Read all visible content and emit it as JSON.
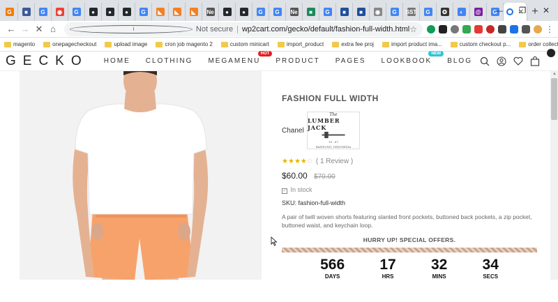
{
  "browser": {
    "url_prefix": "Not secure",
    "url": "wp2cart.com/gecko/default/fashion-full-width.html",
    "tabs": [
      {
        "glyph": "G",
        "color": "#f57c00"
      },
      {
        "glyph": "■",
        "color": "#3b5998"
      },
      {
        "glyph": "G",
        "color": "#4285f4"
      },
      {
        "glyph": "◉",
        "color": "#ea4335"
      },
      {
        "glyph": "G",
        "color": "#4285f4"
      },
      {
        "glyph": "●",
        "color": "#24292e"
      },
      {
        "glyph": "●",
        "color": "#24292e"
      },
      {
        "glyph": "●",
        "color": "#24292e"
      },
      {
        "glyph": "G",
        "color": "#4285f4"
      },
      {
        "glyph": "◣",
        "color": "#f48024"
      },
      {
        "glyph": "◣",
        "color": "#f48024"
      },
      {
        "glyph": "◣",
        "color": "#f48024"
      },
      {
        "glyph": "Ne",
        "color": "#555555"
      },
      {
        "glyph": "●",
        "color": "#24292e"
      },
      {
        "glyph": "●",
        "color": "#24292e"
      },
      {
        "glyph": "G",
        "color": "#4285f4"
      },
      {
        "glyph": "G",
        "color": "#4285f4"
      },
      {
        "glyph": "Ne",
        "color": "#555555"
      },
      {
        "glyph": "■",
        "color": "#1b8a5a"
      },
      {
        "glyph": "G",
        "color": "#4285f4"
      },
      {
        "glyph": "■",
        "color": "#1f4e9c"
      },
      {
        "glyph": "■",
        "color": "#1f4e9c"
      },
      {
        "glyph": "◉",
        "color": "#888888"
      },
      {
        "glyph": "G",
        "color": "#4285f4"
      },
      {
        "glyph": "SST",
        "color": "#777777"
      },
      {
        "glyph": "G",
        "color": "#4285f4"
      },
      {
        "glyph": "✪",
        "color": "#333333"
      },
      {
        "glyph": "◐",
        "color": "#4285f4"
      },
      {
        "glyph": "@",
        "color": "#7b1fa2"
      },
      {
        "glyph": "G",
        "color": "#4285f4"
      }
    ],
    "bookmarks": [
      "magento",
      "onepagecheckout",
      "upload image",
      "cron job magento 2",
      "custom minicart",
      "import_product",
      "extra fee proj",
      "import product ima...",
      "custom checkout p...",
      "order collection"
    ]
  },
  "site": {
    "logo": "GECKO",
    "nav": [
      {
        "label": "HOME",
        "badge": ""
      },
      {
        "label": "CLOTHING",
        "badge": ""
      },
      {
        "label": "MEGAMENU",
        "badge": "HOT"
      },
      {
        "label": "PRODUCT",
        "badge": ""
      },
      {
        "label": "PAGES",
        "badge": ""
      },
      {
        "label": "LOOKBOOK",
        "badge": "NEW"
      },
      {
        "label": "BLOG",
        "badge": ""
      }
    ]
  },
  "product": {
    "title": "FASHION FULL WIDTH",
    "brand_label": "Chanel",
    "brand_logo": {
      "top": "The",
      "name": "LUMBER JACK",
      "sub": "BANDUNG, INDONESIA",
      "est": "19 · 67"
    },
    "rating": 4,
    "rating_max": 5,
    "review_text": "( 1  Review )",
    "price": "$60.00",
    "old_price": "$70.00",
    "stock": "In stock",
    "sku_label": "SKU:",
    "sku": "fashion-full-width",
    "description": "A pair of twill woven shorts featuring slanted front pockets, buttoned back pockets, a zip pocket, buttoned waist, and keychain loop.",
    "offer_text": "HURRY UP! SPECIAL OFFERS.",
    "countdown": [
      {
        "value": "566",
        "label": "DAYS"
      },
      {
        "value": "17",
        "label": "HRS"
      },
      {
        "value": "32",
        "label": "MINS"
      },
      {
        "value": "34",
        "label": "SECS"
      }
    ]
  },
  "colors": {
    "accent": "#e31e24",
    "new_badge": "#2ec5d3",
    "star": "#e6b400"
  }
}
